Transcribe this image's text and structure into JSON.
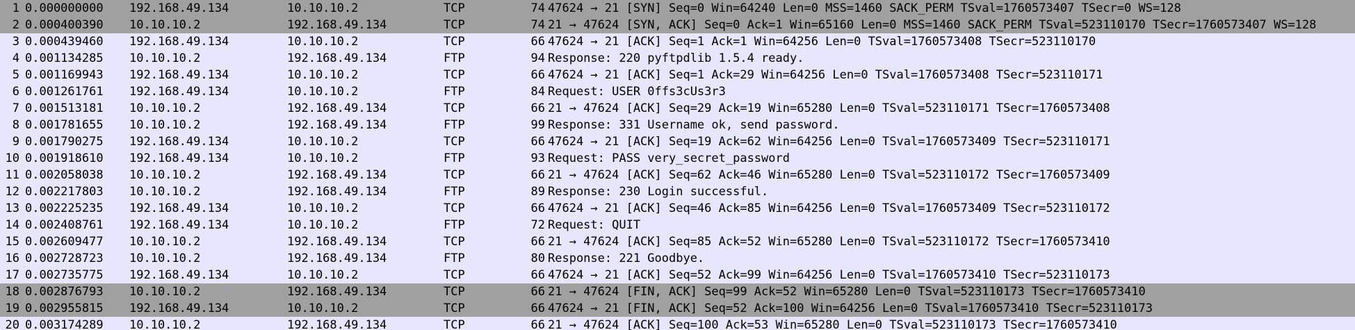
{
  "packets": [
    {
      "no": "1",
      "time": "0.000000000",
      "source": "192.168.49.134",
      "destination": "10.10.10.2",
      "protocol": "TCP",
      "length": "74",
      "info": "47624 → 21 [SYN] Seq=0 Win=64240 Len=0 MSS=1460 SACK_PERM TSval=1760573407 TSecr=0 WS=128",
      "style": "syn"
    },
    {
      "no": "2",
      "time": "0.000400390",
      "source": "10.10.10.2",
      "destination": "192.168.49.134",
      "protocol": "TCP",
      "length": "74",
      "info": "21 → 47624 [SYN, ACK] Seq=0 Ack=1 Win=65160 Len=0 MSS=1460 SACK_PERM TSval=523110170 TSecr=1760573407 WS=128",
      "style": "syn"
    },
    {
      "no": "3",
      "time": "0.000439460",
      "source": "192.168.49.134",
      "destination": "10.10.10.2",
      "protocol": "TCP",
      "length": "66",
      "info": "47624 → 21 [ACK] Seq=1 Ack=1 Win=64256 Len=0 TSval=1760573408 TSecr=523110170",
      "style": "tcp"
    },
    {
      "no": "4",
      "time": "0.001134285",
      "source": "10.10.10.2",
      "destination": "192.168.49.134",
      "protocol": "FTP",
      "length": "94",
      "info": "Response: 220 pyftpdlib 1.5.4 ready.",
      "style": "tcp"
    },
    {
      "no": "5",
      "time": "0.001169943",
      "source": "192.168.49.134",
      "destination": "10.10.10.2",
      "protocol": "TCP",
      "length": "66",
      "info": "47624 → 21 [ACK] Seq=1 Ack=29 Win=64256 Len=0 TSval=1760573408 TSecr=523110171",
      "style": "tcp"
    },
    {
      "no": "6",
      "time": "0.001261761",
      "source": "192.168.49.134",
      "destination": "10.10.10.2",
      "protocol": "FTP",
      "length": "84",
      "info": "Request: USER 0ffs3cUs3r3",
      "style": "tcp"
    },
    {
      "no": "7",
      "time": "0.001513181",
      "source": "10.10.10.2",
      "destination": "192.168.49.134",
      "protocol": "TCP",
      "length": "66",
      "info": "21 → 47624 [ACK] Seq=29 Ack=19 Win=65280 Len=0 TSval=523110171 TSecr=1760573408",
      "style": "tcp"
    },
    {
      "no": "8",
      "time": "0.001781655",
      "source": "10.10.10.2",
      "destination": "192.168.49.134",
      "protocol": "FTP",
      "length": "99",
      "info": "Response: 331 Username ok, send password.",
      "style": "tcp"
    },
    {
      "no": "9",
      "time": "0.001790275",
      "source": "192.168.49.134",
      "destination": "10.10.10.2",
      "protocol": "TCP",
      "length": "66",
      "info": "47624 → 21 [ACK] Seq=19 Ack=62 Win=64256 Len=0 TSval=1760573409 TSecr=523110171",
      "style": "tcp"
    },
    {
      "no": "10",
      "time": "0.001918610",
      "source": "192.168.49.134",
      "destination": "10.10.10.2",
      "protocol": "FTP",
      "length": "93",
      "info": "Request: PASS very_secret_password",
      "style": "tcp"
    },
    {
      "no": "11",
      "time": "0.002058038",
      "source": "10.10.10.2",
      "destination": "192.168.49.134",
      "protocol": "TCP",
      "length": "66",
      "info": "21 → 47624 [ACK] Seq=62 Ack=46 Win=65280 Len=0 TSval=523110172 TSecr=1760573409",
      "style": "tcp"
    },
    {
      "no": "12",
      "time": "0.002217803",
      "source": "10.10.10.2",
      "destination": "192.168.49.134",
      "protocol": "FTP",
      "length": "89",
      "info": "Response: 230 Login successful.",
      "style": "tcp"
    },
    {
      "no": "13",
      "time": "0.002225235",
      "source": "192.168.49.134",
      "destination": "10.10.10.2",
      "protocol": "TCP",
      "length": "66",
      "info": "47624 → 21 [ACK] Seq=46 Ack=85 Win=64256 Len=0 TSval=1760573409 TSecr=523110172",
      "style": "tcp"
    },
    {
      "no": "14",
      "time": "0.002408761",
      "source": "192.168.49.134",
      "destination": "10.10.10.2",
      "protocol": "FTP",
      "length": "72",
      "info": "Request: QUIT",
      "style": "tcp"
    },
    {
      "no": "15",
      "time": "0.002609477",
      "source": "10.10.10.2",
      "destination": "192.168.49.134",
      "protocol": "TCP",
      "length": "66",
      "info": "21 → 47624 [ACK] Seq=85 Ack=52 Win=65280 Len=0 TSval=523110172 TSecr=1760573410",
      "style": "tcp"
    },
    {
      "no": "16",
      "time": "0.002728723",
      "source": "10.10.10.2",
      "destination": "192.168.49.134",
      "protocol": "FTP",
      "length": "80",
      "info": "Response: 221 Goodbye.",
      "style": "tcp"
    },
    {
      "no": "17",
      "time": "0.002735775",
      "source": "192.168.49.134",
      "destination": "10.10.10.2",
      "protocol": "TCP",
      "length": "66",
      "info": "47624 → 21 [ACK] Seq=52 Ack=99 Win=64256 Len=0 TSval=1760573410 TSecr=523110173",
      "style": "tcp"
    },
    {
      "no": "18",
      "time": "0.002876793",
      "source": "10.10.10.2",
      "destination": "192.168.49.134",
      "protocol": "TCP",
      "length": "66",
      "info": "21 → 47624 [FIN, ACK] Seq=99 Ack=52 Win=65280 Len=0 TSval=523110173 TSecr=1760573410",
      "style": "fin"
    },
    {
      "no": "19",
      "time": "0.002955815",
      "source": "192.168.49.134",
      "destination": "10.10.10.2",
      "protocol": "TCP",
      "length": "66",
      "info": "47624 → 21 [FIN, ACK] Seq=52 Ack=100 Win=64256 Len=0 TSval=1760573410 TSecr=523110173",
      "style": "fin"
    },
    {
      "no": "20",
      "time": "0.003174289",
      "source": "10.10.10.2",
      "destination": "192.168.49.134",
      "protocol": "TCP",
      "length": "66",
      "info": "21 → 47624 [ACK] Seq=100 Ack=53 Win=65280 Len=0 TSval=523110173 TSecr=1760573410",
      "style": "tcp"
    }
  ],
  "colors": {
    "tcp_row": "#e7e6ff",
    "syn_fin_row": "#a0a0a0"
  }
}
